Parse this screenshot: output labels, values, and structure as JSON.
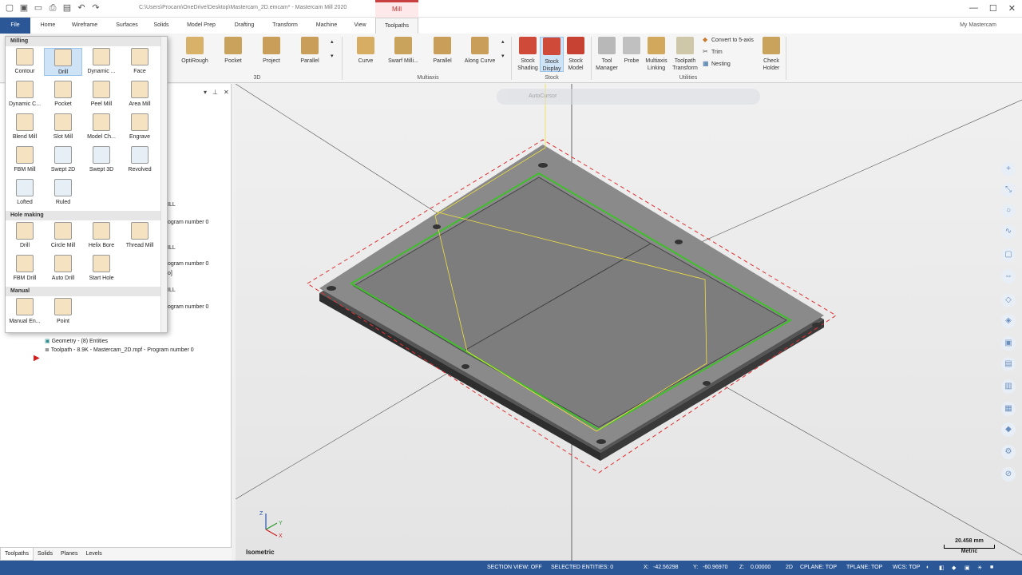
{
  "titlebar": {
    "document_title": "C:\\Users\\Procam\\OneDrive\\Desktop\\Mastercam_2D.emcam* - Mastercam Mill 2020",
    "context_tab": "Mill",
    "minimize": "—",
    "maximize": "☐",
    "close": "✕"
  },
  "tabs": {
    "file": "File",
    "home": "Home",
    "wireframe": "Wireframe",
    "surfaces": "Surfaces",
    "solids": "Solids",
    "model_prep": "Model Prep",
    "drafting": "Drafting",
    "transform": "Transform",
    "machine": "Machine",
    "view": "View",
    "toolpaths": "Toolpaths",
    "my_mastercam": "My Mastercam"
  },
  "ribbon": {
    "group_3d": {
      "label": "3D",
      "buttons": [
        "OptiRough",
        "Pocket",
        "Project",
        "Parallel"
      ]
    },
    "group_multiaxis": {
      "label": "Multiaxis",
      "buttons": [
        "Curve",
        "Swarf Milli...",
        "Parallel",
        "Along Curve"
      ]
    },
    "group_stock": {
      "label": "Stock",
      "buttons": [
        {
          "line1": "Stock",
          "line2": "Shading"
        },
        {
          "line1": "Stock",
          "line2": "Display"
        },
        {
          "line1": "Stock",
          "line2": "Model"
        }
      ]
    },
    "group_utilities": {
      "label": "Utilities",
      "buttons": [
        {
          "line1": "Tool",
          "line2": "Manager"
        },
        {
          "line1": "Probe",
          "line2": ""
        },
        {
          "line1": "Multiaxis",
          "line2": "Linking"
        },
        {
          "line1": "Toolpath",
          "line2": "Transform"
        }
      ],
      "small": [
        "Convert to 5-axis",
        "Trim",
        "Nesting"
      ],
      "check_holder": {
        "line1": "Check",
        "line2": "Holder"
      }
    }
  },
  "gallery": {
    "sections": [
      {
        "title": "Milling",
        "items": [
          "Contour",
          "Drill",
          "Dynamic ...",
          "Face",
          "Dynamic C...",
          "Pocket",
          "Peel Mill",
          "Area Mill",
          "Blend Mill",
          "Slot Mill",
          "Model Ch...",
          "Engrave",
          "FBM Mill",
          "Swept 2D",
          "Swept 3D",
          "Revolved",
          "Lofted",
          "Ruled"
        ]
      },
      {
        "title": "Hole making",
        "items": [
          "Drill",
          "Circle Mill",
          "Helix Bore",
          "Thread Mill",
          "FBM Drill",
          "Auto Drill",
          "Start Hole"
        ]
      },
      {
        "title": "Manual",
        "items": [
          "Manual En...",
          "Point"
        ]
      }
    ]
  },
  "tree": {
    "partial_1": "ILL",
    "partial_2": "ogram number 0",
    "partial_3": "ILL",
    "partial_4": "ogram number 0",
    "partial_5": "o]",
    "partial_6": "ILL",
    "partial_7": "ogram number 0",
    "geometry": "Geometry - (8) Entities",
    "toolpath": "Toolpath - 8.9K - Mastercam_2D.mpf - Program number 0"
  },
  "bottom_tabs": [
    "Toolpaths",
    "Solids",
    "Planes",
    "Levels"
  ],
  "viewport": {
    "autocursor": "AutoCursor",
    "view_label": "Isometric",
    "scale_value": "20.458 mm",
    "scale_unit": "Metric",
    "axis_x": "X",
    "axis_y": "Y",
    "axis_z": "Z"
  },
  "status": {
    "section_view": "SECTION VIEW: OFF",
    "selected": "SELECTED ENTITIES: 0",
    "x_label": "X:",
    "x_value": "-42.56298",
    "y_label": "Y:",
    "y_value": "-60.96970",
    "z_label": "Z:",
    "z_value": "0.00000",
    "mode": "2D",
    "cplane": "CPLANE: TOP",
    "tplane": "TPLANE: TOP",
    "wcs": "WCS: TOP"
  },
  "colors": {
    "file_tab": "#2b5797",
    "status_bar": "#2b5797",
    "toolpath_green": "#3fbf2a",
    "rapid_yellow": "#f0e040",
    "stock_red": "#e03030"
  }
}
